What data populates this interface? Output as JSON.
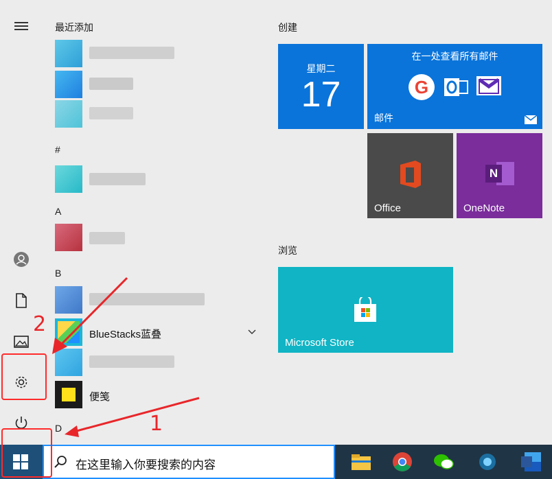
{
  "app_list": {
    "recent_header": "最近添加",
    "section_hash": "#",
    "section_a": "A",
    "section_b": "B",
    "bluestacks_label": "BlueStacks蓝叠",
    "sticky_label": "便笺",
    "section_d": "D"
  },
  "tiles": {
    "group_create": "创建",
    "group_browse": "浏览",
    "calendar_weekday": "星期二",
    "calendar_day": "17",
    "mail_header": "在一处查看所有邮件",
    "mail_label": "邮件",
    "office_label": "Office",
    "onenote_label": "OneNote",
    "store_label": "Microsoft Store",
    "google_letter": "G",
    "onenote_letter": "N"
  },
  "taskbar": {
    "search_placeholder": "在这里输入你要搜索的内容"
  },
  "annotations": {
    "label_1": "1",
    "label_2": "2"
  },
  "colors": {
    "tile_blue": "#0a74da",
    "office_tile": "#4a4a4a",
    "onenote_tile": "#7a2d9b",
    "store_tile": "#10b4c4",
    "taskbar": "#1f3445",
    "annotation_red": "#ff2a2a"
  },
  "icons": [
    "hamburger-icon",
    "user-icon",
    "document-icon",
    "pictures-icon",
    "settings-icon",
    "power-icon",
    "windows-logo-icon",
    "search-icon",
    "file-explorer-icon",
    "chrome-icon",
    "wechat-icon",
    "word-icon",
    "chevron-down-icon"
  ]
}
